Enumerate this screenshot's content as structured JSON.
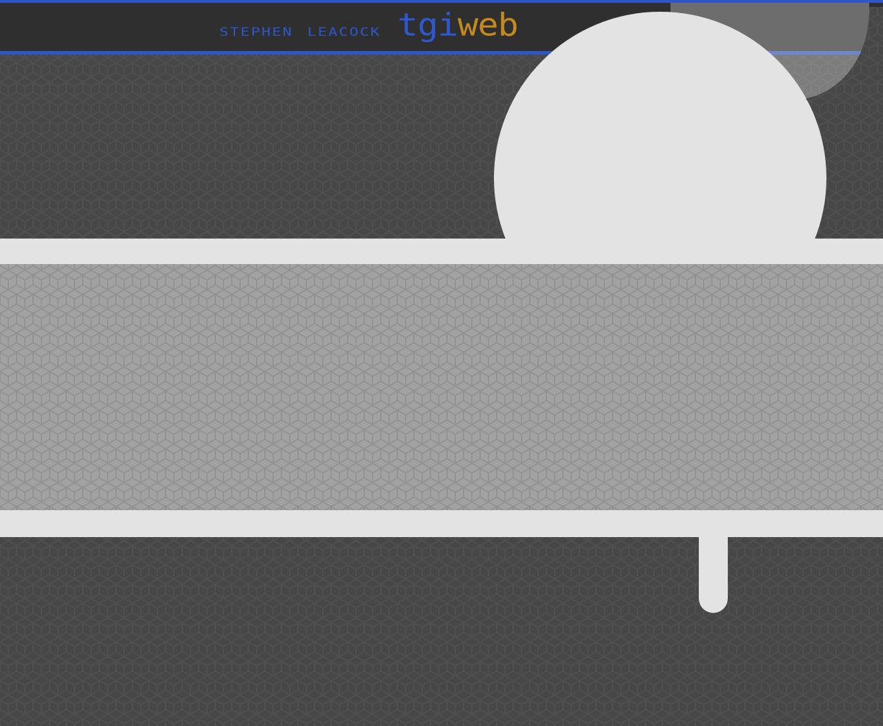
{
  "header": {
    "name_text": "stephen leacock",
    "brand_part1": "tgi",
    "brand_part2": "web"
  },
  "colors": {
    "accent_blue": "#2f56c8",
    "accent_gold": "#c68a1b",
    "dark_background": "#474747",
    "mid_band": "#a3a3a3",
    "light_shape": "#e3e3e3"
  }
}
